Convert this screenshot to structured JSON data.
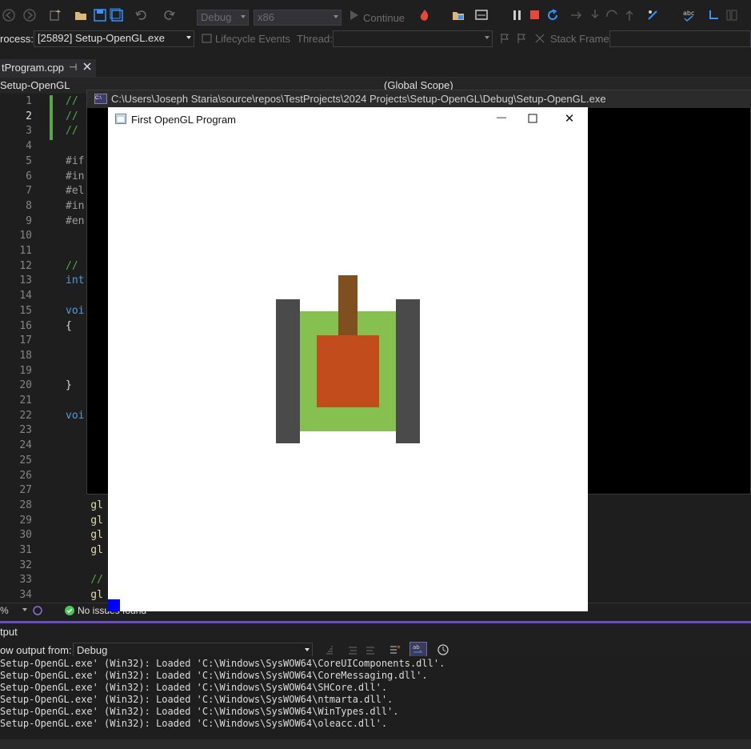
{
  "toolbar": {
    "config_value": "Debug",
    "platform_value": "x86",
    "continue_label": "Continue"
  },
  "debug_bar": {
    "process_label": "rocess:",
    "process_value": "[25892] Setup-OpenGL.exe",
    "lifecycle_label": "Lifecycle Events",
    "thread_label": "Thread:",
    "stack_frame_label": "Stack Frame:"
  },
  "doc_tab": {
    "filename": "tProgram.cpp",
    "pin_glyph": "⊣"
  },
  "nav_bar": {
    "project": "Setup-OpenGL",
    "scope": "(Global Scope)"
  },
  "editor": {
    "line_numbers": [
      "1",
      "2",
      "3",
      "4",
      "5",
      "6",
      "7",
      "8",
      "9",
      "10",
      "11",
      "12",
      "13",
      "14",
      "15",
      "16",
      "17",
      "18",
      "19",
      "20",
      "21",
      "22",
      "23",
      "24",
      "25",
      "26",
      "27",
      "28",
      "29",
      "30",
      "31",
      "32",
      "33",
      "34"
    ],
    "current_line": "2",
    "code_fragments": [
      {
        "line": 1,
        "text": "// "
      },
      {
        "line": 2,
        "text": "//"
      },
      {
        "line": 3,
        "text": "//"
      },
      {
        "line": 5,
        "text": "#if"
      },
      {
        "line": 6,
        "text": "#in"
      },
      {
        "line": 7,
        "text": "#el"
      },
      {
        "line": 8,
        "text": "#in"
      },
      {
        "line": 9,
        "text": "#en"
      },
      {
        "line": 12,
        "text": "// "
      },
      {
        "line": 13,
        "text": "int"
      },
      {
        "line": 15,
        "text": "voi"
      },
      {
        "line": 16,
        "text": "{"
      },
      {
        "line": 20,
        "text": "}"
      },
      {
        "line": 22,
        "text": "voi"
      },
      {
        "line": 28,
        "text": "    gl"
      },
      {
        "line": 29,
        "text": "    gl"
      },
      {
        "line": 30,
        "text": "    gl"
      },
      {
        "line": 31,
        "text": "    gl"
      },
      {
        "line": 33,
        "text": "    //"
      },
      {
        "line": 34,
        "text": "    gl"
      }
    ]
  },
  "status_bar": {
    "zoom": "%",
    "issues": "No issues found"
  },
  "output": {
    "title": "tput",
    "show_from_label": "ow output from:",
    "source_value": "Debug",
    "lines": [
      "Setup-OpenGL.exe' (Win32): Loaded 'C:\\Windows\\SysWOW64\\CoreUIComponents.dll'.",
      "Setup-OpenGL.exe' (Win32): Loaded 'C:\\Windows\\SysWOW64\\CoreMessaging.dll'.",
      "Setup-OpenGL.exe' (Win32): Loaded 'C:\\Windows\\SysWOW64\\SHCore.dll'.",
      "Setup-OpenGL.exe' (Win32): Loaded 'C:\\Windows\\SysWOW64\\ntmarta.dll'.",
      "Setup-OpenGL.exe' (Win32): Loaded 'C:\\Windows\\SysWOW64\\WinTypes.dll'.",
      "Setup-OpenGL.exe' (Win32): Loaded 'C:\\Windows\\SysWOW64\\oleacc.dll'."
    ]
  },
  "console_window": {
    "icon": "C:\\",
    "title": "C:\\Users\\Joseph Staria\\source\\repos\\TestProjects\\2024 Projects\\Setup-OpenGL\\Debug\\Setup-OpenGL.exe"
  },
  "gl_window": {
    "title": "First OpenGL Program",
    "minimize_glyph": "—",
    "close_glyph": "✕",
    "colors": {
      "tracks": "#4a4a4a",
      "body": "#85c051",
      "turret": "#c24c1b",
      "barrel": "#7f4f20",
      "corner_square": "#0000ff"
    }
  }
}
